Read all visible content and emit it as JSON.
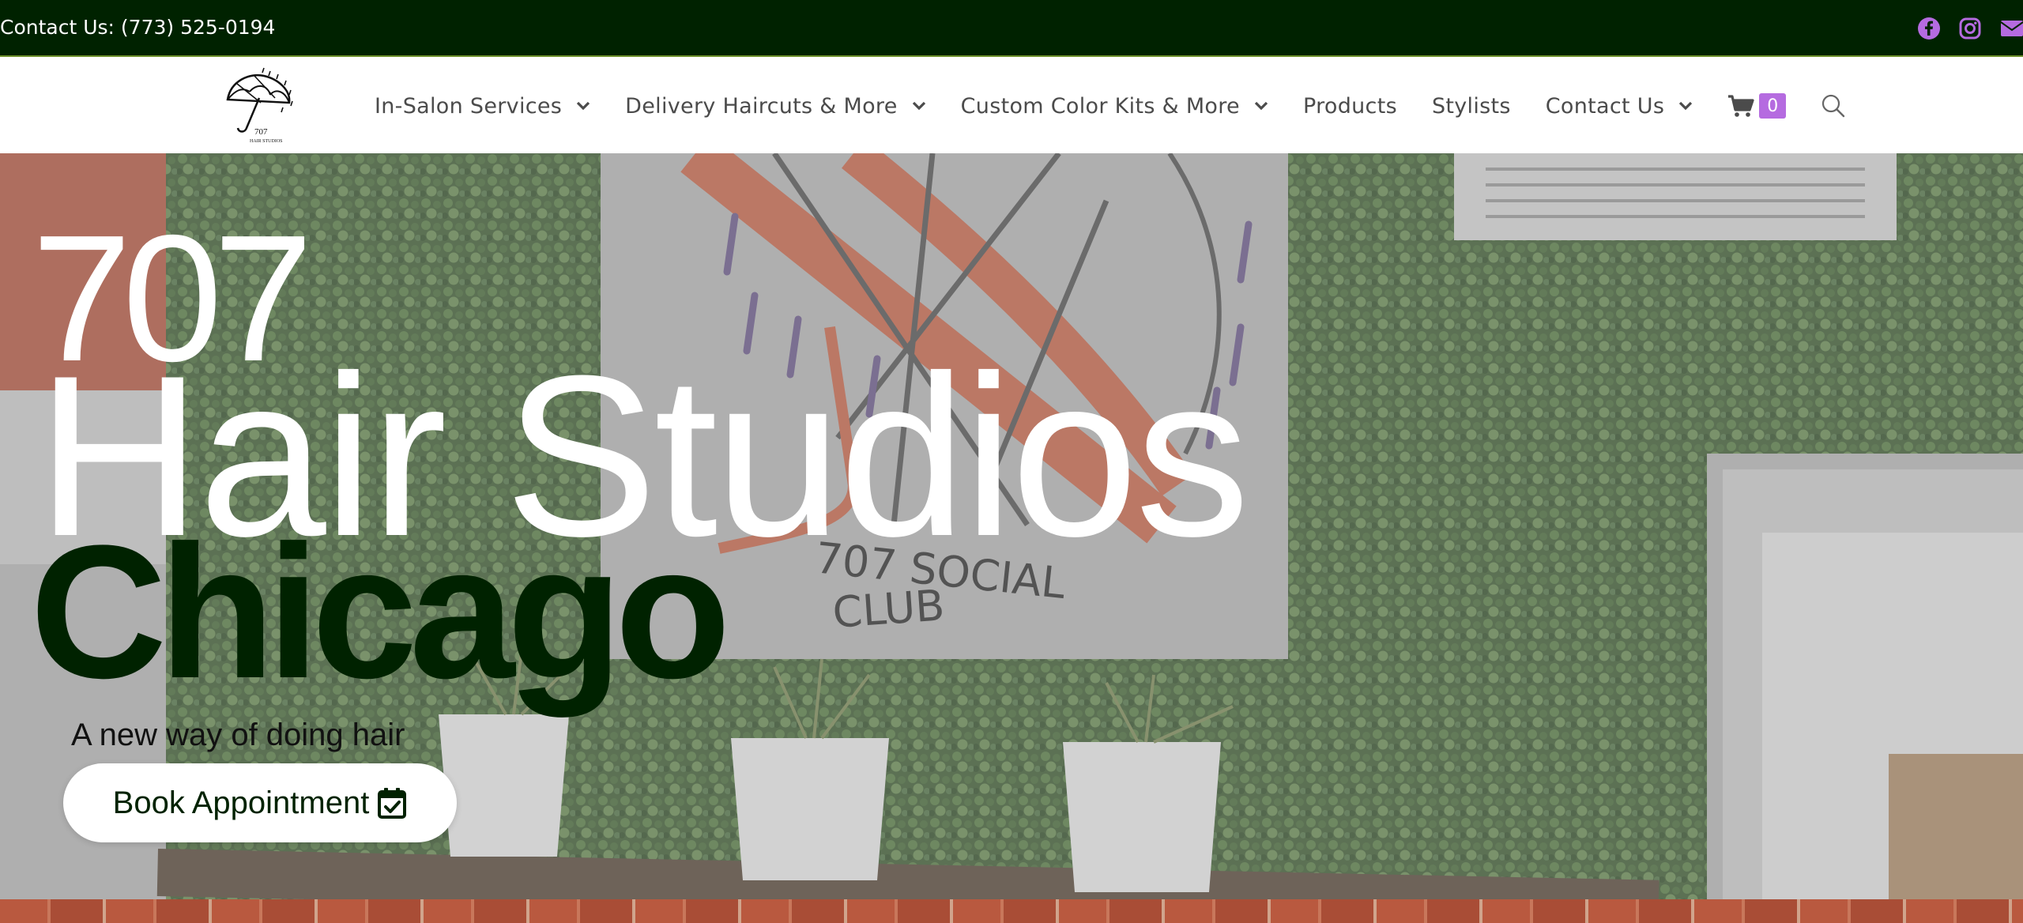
{
  "topbar": {
    "contact_text": "Contact Us: (773) 525-0194",
    "social_icons": [
      "facebook-icon",
      "instagram-icon",
      "email-icon"
    ],
    "background_color": "#002200",
    "icon_color": "#b56be0"
  },
  "nav": {
    "logo_text": "707",
    "items": [
      {
        "label": "In-Salon Services",
        "has_dropdown": true
      },
      {
        "label": "Delivery Haircuts & More",
        "has_dropdown": true
      },
      {
        "label": "Custom Color Kits & More",
        "has_dropdown": true
      },
      {
        "label": "Products",
        "has_dropdown": false
      },
      {
        "label": "Stylists",
        "has_dropdown": false
      },
      {
        "label": "Contact Us",
        "has_dropdown": true
      }
    ],
    "cart_count": "0",
    "cart_icon": "shopping-cart-icon",
    "search_icon": "search-icon",
    "accent_color": "#b56be0"
  },
  "hero": {
    "title_line1": "707",
    "title_line2": "Hair Studios",
    "title_line3": "Chicago",
    "mural_text_line1": "707 SOCIAL",
    "mural_text_line2": "CLUB",
    "tagline": "A new way of doing hair",
    "cta_label": "Book Appointment",
    "cta_icon": "calendar-check-icon",
    "brand_dark_green": "#002200"
  }
}
